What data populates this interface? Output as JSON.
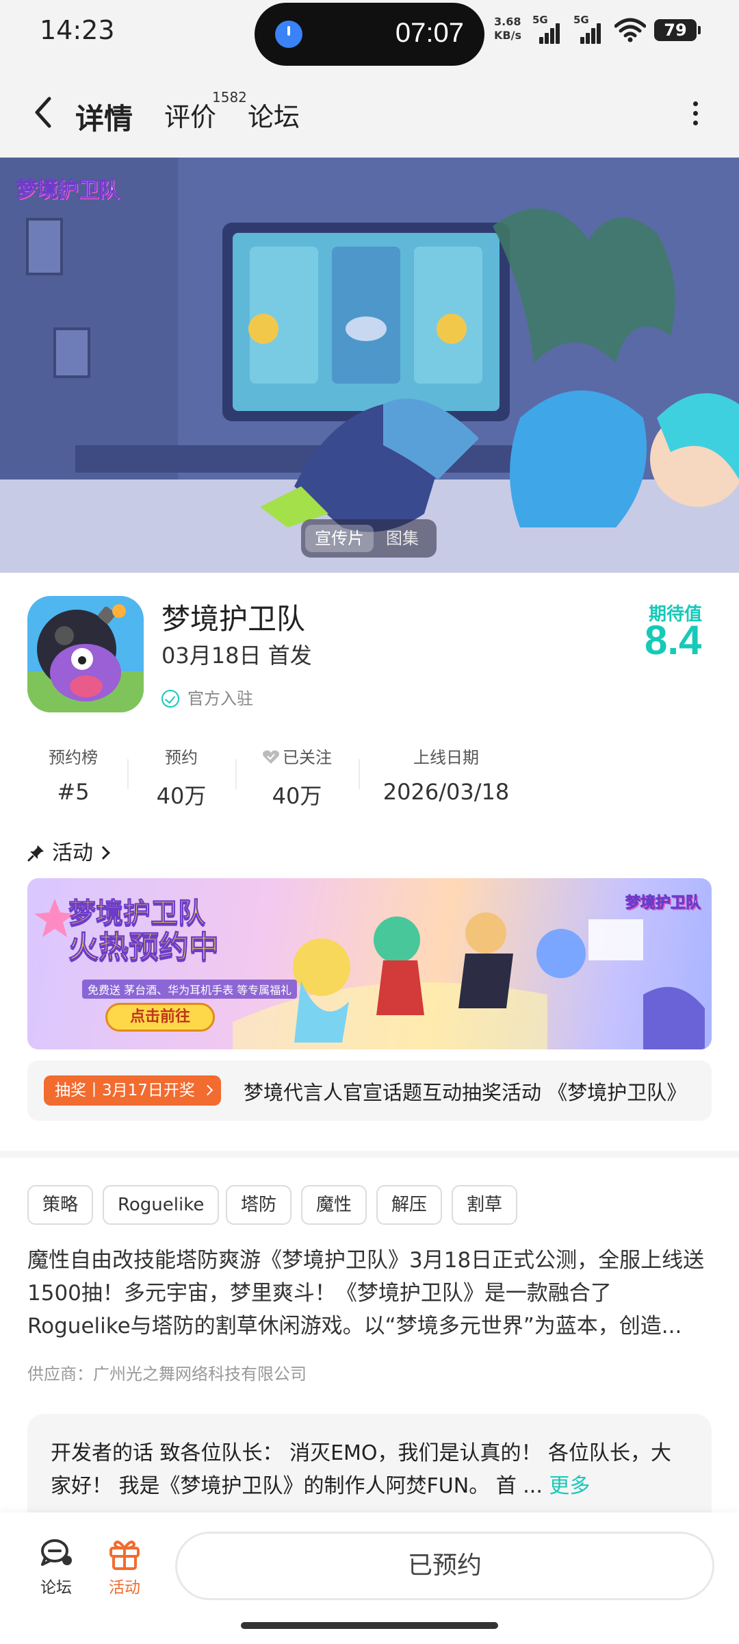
{
  "status_bar": {
    "time": "14:23",
    "timer": "07:07",
    "net_speed_value": "3.68",
    "net_speed_unit": "KB/s",
    "signal_1": "5G",
    "signal_2": "5G",
    "battery": "79"
  },
  "header": {
    "tabs": [
      {
        "label": "详情",
        "active": true
      },
      {
        "label": "评价",
        "count": "1582"
      },
      {
        "label": "论坛"
      }
    ]
  },
  "banner": {
    "logo_text": "梦境护卫队",
    "media_options": [
      "宣传片",
      "图集"
    ],
    "selected_media": "宣传片"
  },
  "game": {
    "title": "梦境护卫队",
    "release": "03月18日 首发",
    "verified": "官方入驻",
    "expect_label": "期待值",
    "expect_score": "8.4"
  },
  "stats": [
    {
      "label": "预约榜",
      "value": "#5"
    },
    {
      "label": "预约",
      "value": "40万"
    },
    {
      "label": "已关注",
      "value": "40万"
    },
    {
      "label": "上线日期",
      "value": "2026/03/18"
    }
  ],
  "activity": {
    "heading": "活动",
    "promo": {
      "title_line1": "梦境护卫队",
      "title_line2": "火热预约中",
      "subtitle": "免费送 茅台酒、华为耳机手表 等专属福礼",
      "button": "点击前往",
      "logo_text": "梦境护卫队"
    },
    "lottery_tag": "抽奖丨3月17日开奖",
    "lottery_text": "梦境代言人官宣话题互动抽奖活动 《梦境护卫队》"
  },
  "tags": [
    "策略",
    "Roguelike",
    "塔防",
    "魔性",
    "解压",
    "割草"
  ],
  "description": "魔性自由改技能塔防爽游《梦境护卫队》3月18日正式公测，全服上线送1500抽！多元宇宙，梦里爽斗！《梦境护卫队》是一款融合了Roguelike与塔防的割草休闲游戏。以“梦境多元世界”为蓝本，创造...",
  "supplier": "供应商：广州光之舞网络科技有限公司",
  "developer_note": {
    "text": "开发者的话  致各位队长： 消灭EMO，我们是认真的！ 各位队长，大家好！ 我是《梦境护卫队》的制作人阿焚FUN。 首 ...",
    "more": "更多"
  },
  "bottom_bar": {
    "forum_label": "论坛",
    "activity_label": "活动",
    "action_button": "已预约"
  },
  "colors": {
    "accent": "#17c9b9",
    "orange": "#f26b2f"
  }
}
